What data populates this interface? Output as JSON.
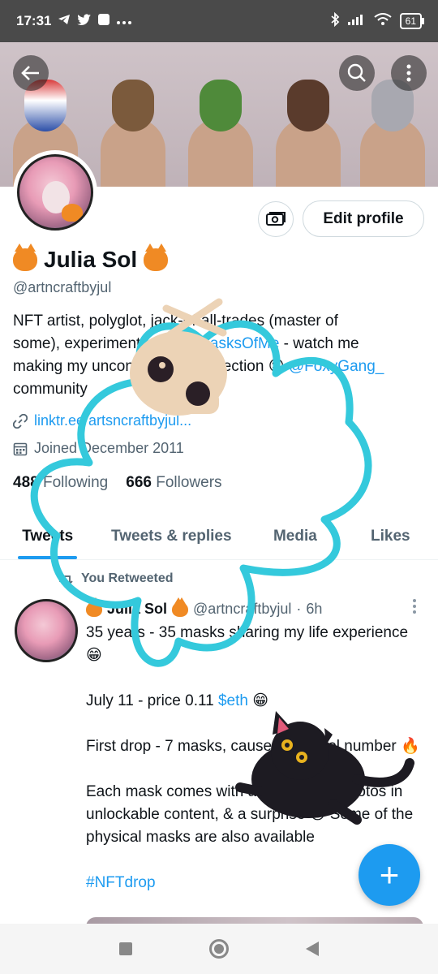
{
  "status_bar": {
    "time": "17:31",
    "battery": "61",
    "left_icons": [
      "telegram-icon",
      "twitter-icon",
      "square-app-icon",
      "more-dots-icon"
    ],
    "right_icons": [
      "bluetooth-icon",
      "signal-icon",
      "wifi-icon",
      "battery-icon"
    ]
  },
  "header": {
    "back_icon": "arrow-left-icon",
    "search_icon": "search-icon",
    "more_icon": "more-vertical-icon"
  },
  "profile": {
    "display_name": "Julia Sol",
    "handle": "@artncraftbyjul",
    "bio_lines": [
      "NFT artist, polyglot, jack-of-all-trades (master of",
      "some), experimenter. ",
      "#TheMasksOfMe",
      " - watch me",
      "making my unconventional collection ",
      "😊",
      "@FoxyGang_",
      "community"
    ],
    "link": "linktr.ee/artsncraftbyjul...",
    "joined": "Joined December 2011",
    "following_count": "488",
    "following_label": "Following",
    "followers_count": "666",
    "followers_label": "Followers",
    "edit_profile_label": "Edit profile"
  },
  "tabs": [
    {
      "label": "Tweets",
      "active": true
    },
    {
      "label": "Tweets & replies",
      "active": false
    },
    {
      "label": "Media",
      "active": false
    },
    {
      "label": "Likes",
      "active": false
    }
  ],
  "tweet": {
    "retweet_label": "You Retweeted",
    "author_name": "Julia Sol",
    "author_handle": "@artncraftbyjul",
    "separator": "·",
    "time": "6h",
    "body": [
      "35 years - 35 masks sharing my life experience 😁",
      "July 11 - price 0.11 ",
      "$eth",
      " 😁",
      "First drop - 7 masks, cause it's a cool number 🔥",
      "Each mask comes with a story, extra photos in unlockable content, & a surprise 😊 Some of the physical masks are also available",
      "#NFTdrop"
    ]
  },
  "fab": {
    "label": "+"
  },
  "colors": {
    "accent": "#1d9bf0",
    "sticker_outline": "#34c9dc",
    "status_bar": "#4a4a4a"
  }
}
